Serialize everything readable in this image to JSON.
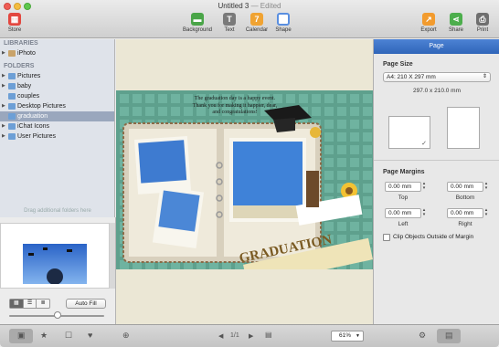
{
  "window": {
    "title": "Untitled 3",
    "edited": "— Edited"
  },
  "toolbar": {
    "store": "Store",
    "background": "Background",
    "text": "Text",
    "calendar": "Calendar",
    "shape": "Shape",
    "export": "Export",
    "share": "Share",
    "print": "Print"
  },
  "sidebar": {
    "libraries_header": "LIBRARIES",
    "libraries": [
      "iPhoto"
    ],
    "folders_header": "FOLDERS",
    "folders": [
      "Pictures",
      "baby",
      "couples",
      "Desktop Pictures",
      "graduation",
      "iChat Icons",
      "User Pictures"
    ],
    "selected_folder": "graduation",
    "drag_hint": "Drag additional folders here"
  },
  "lower_panel": {
    "auto_fill": "Auto Fill"
  },
  "canvas": {
    "message_line1": "The graduation day is a happy event.",
    "message_line2": "Thank you for making it happier, dear,",
    "message_line3": "and congratulations!",
    "banner_text": "GRADUATION"
  },
  "inspector": {
    "tab": "Page",
    "page_size_label": "Page Size",
    "page_size_value": "A4: 210 X 297 mm",
    "page_dims": "297.0 x 210.0 mm",
    "margins_label": "Page Margins",
    "top": "0.00 mm",
    "bottom": "0.00 mm",
    "left": "0.00 mm",
    "right": "0.00 mm",
    "top_label": "Top",
    "bottom_label": "Bottom",
    "left_label": "Left",
    "right_label": "Right",
    "clip_label": "Clip Objects Outside of Margin"
  },
  "bottom": {
    "page_counter": "1/1",
    "zoom": "61%"
  },
  "colors": {
    "accent": "#3a73c8",
    "page_bg": "#6fb3a0"
  }
}
